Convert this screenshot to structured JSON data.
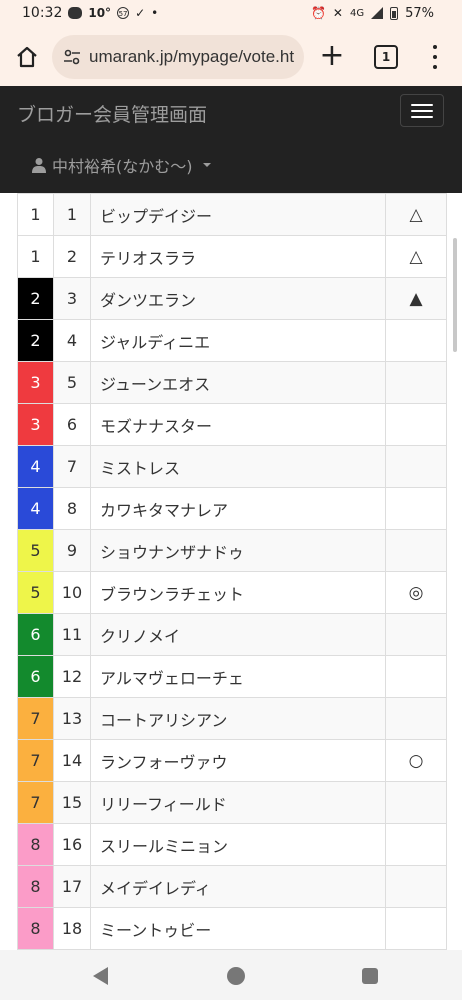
{
  "status_bar": {
    "time": "10:32",
    "temperature": "10°",
    "badge": "57",
    "network": "4G",
    "battery": "57%"
  },
  "browser": {
    "url": "umarank.jp/mypage/vote.ht",
    "tab_count": "1",
    "new_tab_label": "+"
  },
  "header": {
    "brand": "ブロガー会員管理画面",
    "user": "中村裕希(なかむ〜)"
  },
  "colors": {
    "waku": {
      "1": "#ffffff",
      "2": "#000000",
      "3": "#ef3a3f",
      "4": "#2a4ad8",
      "5": "#eef54a",
      "6": "#138a2d",
      "7": "#fbb03f",
      "8": "#fb9cc8"
    },
    "header_bg": "#222222",
    "browser_bg": "#fdf1e9"
  },
  "horses": [
    {
      "waku": "1",
      "umaban": "1",
      "name": "ビップデイジー",
      "mark": "△"
    },
    {
      "waku": "1",
      "umaban": "2",
      "name": "テリオスララ",
      "mark": "△"
    },
    {
      "waku": "2",
      "umaban": "3",
      "name": "ダンツエラン",
      "mark": "▲"
    },
    {
      "waku": "2",
      "umaban": "4",
      "name": "ジャルディニエ",
      "mark": ""
    },
    {
      "waku": "3",
      "umaban": "5",
      "name": "ジューンエオス",
      "mark": ""
    },
    {
      "waku": "3",
      "umaban": "6",
      "name": "モズナナスター",
      "mark": ""
    },
    {
      "waku": "4",
      "umaban": "7",
      "name": "ミストレス",
      "mark": ""
    },
    {
      "waku": "4",
      "umaban": "8",
      "name": "カワキタマナレア",
      "mark": ""
    },
    {
      "waku": "5",
      "umaban": "9",
      "name": "ショウナンザナドゥ",
      "mark": ""
    },
    {
      "waku": "5",
      "umaban": "10",
      "name": "ブラウンラチェット",
      "mark": "◎"
    },
    {
      "waku": "6",
      "umaban": "11",
      "name": "クリノメイ",
      "mark": ""
    },
    {
      "waku": "6",
      "umaban": "12",
      "name": "アルマヴェローチェ",
      "mark": ""
    },
    {
      "waku": "7",
      "umaban": "13",
      "name": "コートアリシアン",
      "mark": ""
    },
    {
      "waku": "7",
      "umaban": "14",
      "name": "ランフォーヴァウ",
      "mark": "○"
    },
    {
      "waku": "7",
      "umaban": "15",
      "name": "リリーフィールド",
      "mark": ""
    },
    {
      "waku": "8",
      "umaban": "16",
      "name": "スリールミニョン",
      "mark": ""
    },
    {
      "waku": "8",
      "umaban": "17",
      "name": "メイデイレディ",
      "mark": ""
    },
    {
      "waku": "8",
      "umaban": "18",
      "name": "ミーントゥビー",
      "mark": ""
    }
  ]
}
